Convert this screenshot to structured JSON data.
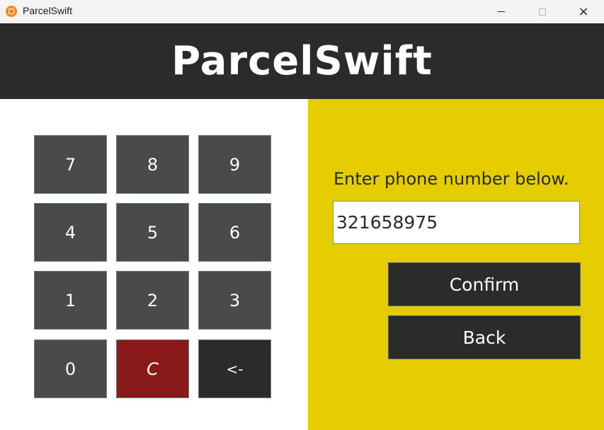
{
  "window": {
    "title": "ParcelSwift",
    "icon": "app-logo-icon",
    "controls": {
      "minimize": "minimize-icon",
      "maximize": "maximize-icon",
      "close": "×"
    }
  },
  "header": {
    "title": "ParcelSwift"
  },
  "keypad": {
    "keys": [
      "7",
      "8",
      "9",
      "4",
      "5",
      "6",
      "1",
      "2",
      "3",
      "0",
      "C",
      "<-"
    ]
  },
  "form": {
    "prompt": "Enter phone number below.",
    "phone_value": "321658975",
    "confirm_label": "Confirm",
    "back_label": "Back"
  },
  "colors": {
    "header_bg": "#2b2b2b",
    "panel_accent": "#e3cc00",
    "key_bg": "#4a4a4a",
    "clear_key_bg": "#8a1a1a",
    "button_bg": "#2b2b2b"
  }
}
